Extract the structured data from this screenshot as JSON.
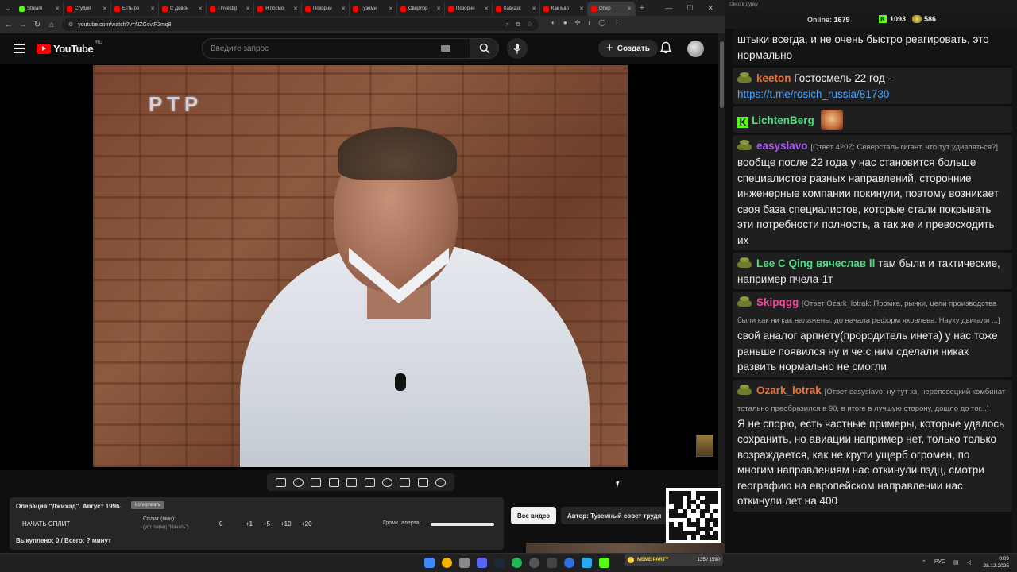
{
  "browser": {
    "tabs": [
      {
        "title": "Stream",
        "favicon": "kick-icon",
        "active": false
      },
      {
        "title": "Студия",
        "favicon": "youtube-icon",
        "active": false
      },
      {
        "title": "Есть ре",
        "favicon": "youtube-icon",
        "active": false
      },
      {
        "title": "С Девон",
        "favicon": "youtube-icon",
        "active": false
      },
      {
        "title": "I Investig",
        "favicon": "youtube-icon",
        "active": false
      },
      {
        "title": "Я посмо",
        "favicon": "youtube-icon",
        "active": false
      },
      {
        "title": "Позорни",
        "favicon": "youtube-icon",
        "active": false
      },
      {
        "title": "Туземн",
        "favicon": "youtube-icon",
        "active": false
      },
      {
        "title": "Оверлор",
        "favicon": "youtube-icon",
        "active": false
      },
      {
        "title": "Позорни",
        "favicon": "youtube-icon",
        "active": false
      },
      {
        "title": "Кавказс",
        "favicon": "youtube-icon",
        "active": false
      },
      {
        "title": "Как мар",
        "favicon": "youtube-icon",
        "active": false
      },
      {
        "title": "Опер",
        "favicon": "youtube-icon",
        "active": true
      }
    ],
    "url": "youtube.com/watch?v=NZGcvtF2mq8"
  },
  "youtube": {
    "logo_text": "YouTube",
    "country_code": "RU",
    "search_placeholder": "Введите запрос",
    "create_label": "Создать"
  },
  "video": {
    "channel_logo": "РТР"
  },
  "split_panel": {
    "title": "Операция \"Джихад\". Август 1996.",
    "copy_label": "Копировать",
    "start_label": "НАЧАТЬ СПЛИТ",
    "split_label": "Сплит (мин):",
    "split_sub": "(уст. перед \"Начать\")",
    "numbers": [
      "0",
      "+1",
      "+5",
      "+10",
      "+20"
    ],
    "alert_label": "Громк. алерта:",
    "bought_label": "Выкуплено: 0 / Всего: ? минут"
  },
  "all_videos_label": "Все видео",
  "author_label": "Автор: Туземный совет трудя",
  "chat": {
    "window_title": "Окно в дурку",
    "online_label": "Online:",
    "online_value": "1679",
    "kick_count": "1093",
    "coin_count": "586",
    "messages": [
      {
        "user": "",
        "user_color": "#ededed",
        "badge": "none",
        "reply": "",
        "text": "штыки всегда, и не очень быстро реагировать, это нормально",
        "link": ""
      },
      {
        "user": "keeton",
        "user_color": "#e8743b",
        "badge": "frog",
        "reply": "",
        "text": "Гостосмель 22 год -",
        "link": "https://t.me/rosich_russia/81730"
      },
      {
        "user": "LichtenBerg",
        "user_color": "#4ade80",
        "badge": "kick",
        "reply": "",
        "text": "",
        "link": ""
      },
      {
        "user": "easyslavo",
        "user_color": "#a855f7",
        "badge": "frog",
        "reply": "[Ответ 420Z: Северсталь гигант, что тут удивляться?]",
        "text": "вообще после 22 года у нас становится больше специалистов разных направлений, сторонние инженерные компании покинули, поэтому возникает своя база специалистов, которые стали покрывать эти потребности полность, а так же и превосходить их",
        "link": ""
      },
      {
        "user": "Lee C Qing",
        "user_color": "#4ade80",
        "badge": "frog",
        "reply": "",
        "user2": "вячеслав ll",
        "text": "там были и тактические, например пчела-1т",
        "link": ""
      },
      {
        "user": "Skipqgg",
        "user_color": "#ec4899",
        "badge": "frog",
        "reply": "[Ответ Ozark_lotrak: Промка, рынки, цепи производства были как ни как налажены, до начала реформ яковлева. Науку двигали ...]",
        "text": "свой аналог арпнету(прородитель инета) у нас тоже раньше появился ну и че с ним сделали никак развить нормально не смогли",
        "link": ""
      },
      {
        "user": "Ozark_lotrak",
        "user_color": "#e8743b",
        "badge": "frog",
        "reply": "[Ответ easyslavo: ну тут хз, череповецкий комбинат тотально преобразился в 90, в итоге в лучшую сторону, дошло до тог...]",
        "text": "Я не спорю, есть частные примеры, которые удалось сохранить, но авиации например нет, только только возраждается, как не крути ущерб огромен, по многим направлениям нас откинули пздц, смотри географию на европейском направлении нас откинули лет на 400",
        "link": ""
      }
    ]
  },
  "taskbar": {
    "meme_party_label": "MEME PARTY",
    "meme_party_count": "135 / 1590",
    "language": "РУС",
    "time": "0:09",
    "date": "28.12.2025"
  }
}
